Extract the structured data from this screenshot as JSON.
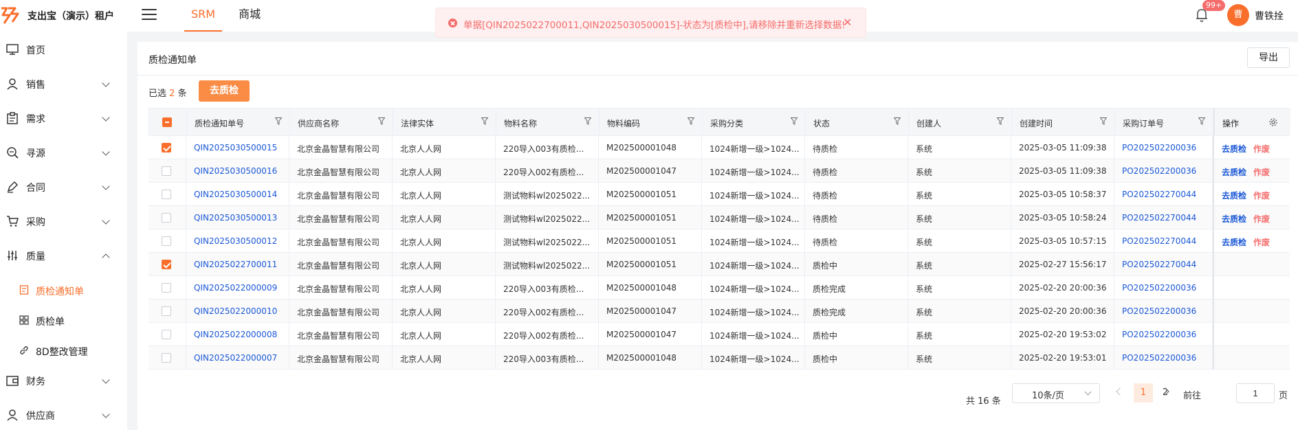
{
  "app": {
    "tenant": "支出宝（演示）租户",
    "nav_tabs": [
      "SRM",
      "商城"
    ],
    "notification_badge": "99+",
    "avatar_initial": "曹",
    "user_name": "曹铁拴"
  },
  "toast": {
    "message": "单据[QIN2025022700011,QIN2025030500015]-状态为[质检中],请移除并重新选择数据!"
  },
  "sidebar": {
    "items": [
      "首页",
      "销售",
      "需求",
      "寻源",
      "合同",
      "采购",
      "质量",
      "财务",
      "供应商"
    ],
    "sub_items": [
      "质检通知单",
      "质检单",
      "8D整改管理"
    ]
  },
  "page": {
    "title": "质检通知单",
    "export_label": "导出",
    "selected_prefix": "已选",
    "selected_count": "2",
    "selected_suffix": "条",
    "qc_button": "去质检"
  },
  "table": {
    "columns": [
      "质检通知单号",
      "供应商名称",
      "法律实体",
      "物料名称",
      "物料编码",
      "采购分类",
      "状态",
      "创建人",
      "创建时间",
      "采购订单号",
      "操作"
    ],
    "rows": [
      {
        "checked": true,
        "no": "QIN2025030500015",
        "supplier": "北京金晶智慧有限公司",
        "entity": "北京人人网",
        "material": "220导入003有质检...",
        "code": "M202500001048",
        "category": "1024新增一级>1024...",
        "status": "待质检",
        "creator": "系统",
        "time": "2025-03-05 11:09:38",
        "po": "PO202502200036",
        "ops": [
          "去质检",
          "作废"
        ]
      },
      {
        "checked": false,
        "no": "QIN2025030500016",
        "supplier": "北京金晶智慧有限公司",
        "entity": "北京人人网",
        "material": "220导入002有质检...",
        "code": "M202500001047",
        "category": "1024新增一级>1024...",
        "status": "待质检",
        "creator": "系统",
        "time": "2025-03-05 11:09:38",
        "po": "PO202502200036",
        "ops": [
          "去质检",
          "作废"
        ]
      },
      {
        "checked": false,
        "no": "QIN2025030500014",
        "supplier": "北京金晶智慧有限公司",
        "entity": "北京人人网",
        "material": "测试物料wl2025022...",
        "code": "M202500001051",
        "category": "1024新增一级>1024...",
        "status": "待质检",
        "creator": "系统",
        "time": "2025-03-05 10:58:37",
        "po": "PO202502270044",
        "ops": [
          "去质检",
          "作废"
        ]
      },
      {
        "checked": false,
        "no": "QIN2025030500013",
        "supplier": "北京金晶智慧有限公司",
        "entity": "北京人人网",
        "material": "测试物料wl2025022...",
        "code": "M202500001051",
        "category": "1024新增一级>1024...",
        "status": "待质检",
        "creator": "系统",
        "time": "2025-03-05 10:58:24",
        "po": "PO202502270044",
        "ops": [
          "去质检",
          "作废"
        ]
      },
      {
        "checked": false,
        "no": "QIN2025030500012",
        "supplier": "北京金晶智慧有限公司",
        "entity": "北京人人网",
        "material": "测试物料wl2025022...",
        "code": "M202500001051",
        "category": "1024新增一级>1024...",
        "status": "待质检",
        "creator": "系统",
        "time": "2025-03-05 10:57:15",
        "po": "PO202502270044",
        "ops": [
          "去质检",
          "作废"
        ]
      },
      {
        "checked": true,
        "no": "QIN2025022700011",
        "supplier": "北京金晶智慧有限公司",
        "entity": "北京人人网",
        "material": "测试物料wl2025022...",
        "code": "M202500001051",
        "category": "1024新增一级>1024...",
        "status": "质检中",
        "creator": "系统",
        "time": "2025-02-27 15:56:17",
        "po": "PO202502270044",
        "ops": []
      },
      {
        "checked": false,
        "no": "QIN2025022000009",
        "supplier": "北京金晶智慧有限公司",
        "entity": "北京人人网",
        "material": "220导入003有质检...",
        "code": "M202500001048",
        "category": "1024新增一级>1024...",
        "status": "质检完成",
        "creator": "系统",
        "time": "2025-02-20 20:00:36",
        "po": "PO202502200036",
        "ops": []
      },
      {
        "checked": false,
        "no": "QIN2025022000010",
        "supplier": "北京金晶智慧有限公司",
        "entity": "北京人人网",
        "material": "220导入002有质检...",
        "code": "M202500001047",
        "category": "1024新增一级>1024...",
        "status": "质检完成",
        "creator": "系统",
        "time": "2025-02-20 20:00:36",
        "po": "PO202502200036",
        "ops": []
      },
      {
        "checked": false,
        "no": "QIN2025022000008",
        "supplier": "北京金晶智慧有限公司",
        "entity": "北京人人网",
        "material": "220导入002有质检...",
        "code": "M202500001047",
        "category": "1024新增一级>1024...",
        "status": "质检中",
        "creator": "系统",
        "time": "2025-02-20 19:53:02",
        "po": "PO202502200036",
        "ops": []
      },
      {
        "checked": false,
        "no": "QIN2025022000007",
        "supplier": "北京金晶智慧有限公司",
        "entity": "北京人人网",
        "material": "220导入003有质检...",
        "code": "M202500001048",
        "category": "1024新增一级>1024...",
        "status": "质检中",
        "creator": "系统",
        "time": "2025-02-20 19:53:01",
        "po": "PO202502200036",
        "ops": []
      }
    ]
  },
  "pagination": {
    "total": "共 16 条",
    "page_size": "10条/页",
    "pages": [
      "1",
      "2"
    ],
    "current_page": "1",
    "goto_label": "前往",
    "goto_value": "1",
    "unit": "页"
  },
  "colors": {
    "accent": "#fa6e2b",
    "link": "#1a57d6",
    "danger": "#f56c6c"
  }
}
